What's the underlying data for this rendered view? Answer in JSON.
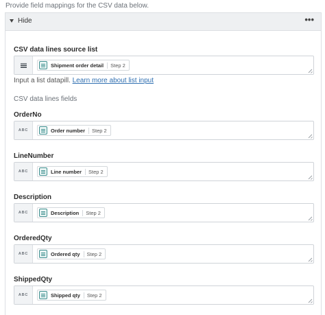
{
  "intro_text": "Provide field mappings for the CSV data below.",
  "panel": {
    "toggle_label": "Hide",
    "more_label": "•••"
  },
  "source_list": {
    "label": "CSV data lines source list",
    "pill": {
      "name": "Shipment order detail",
      "step": "Step 2"
    },
    "hint_text": "Input a list datapill.",
    "hint_link": "Learn more about list input"
  },
  "fields_section_label": "CSV data lines fields",
  "type_badge": "ABC",
  "fields": [
    {
      "label": "OrderNo",
      "pill": {
        "name": "Order number",
        "step": "Step 2"
      }
    },
    {
      "label": "LineNumber",
      "pill": {
        "name": "Line number",
        "step": "Step 2"
      }
    },
    {
      "label": "Description",
      "pill": {
        "name": "Description",
        "step": "Step 2"
      }
    },
    {
      "label": "OrderedQty",
      "pill": {
        "name": "Ordered qty",
        "step": "Step 2"
      }
    },
    {
      "label": "ShippedQty",
      "pill": {
        "name": "Shipped qty",
        "step": "Step 2"
      }
    }
  ]
}
